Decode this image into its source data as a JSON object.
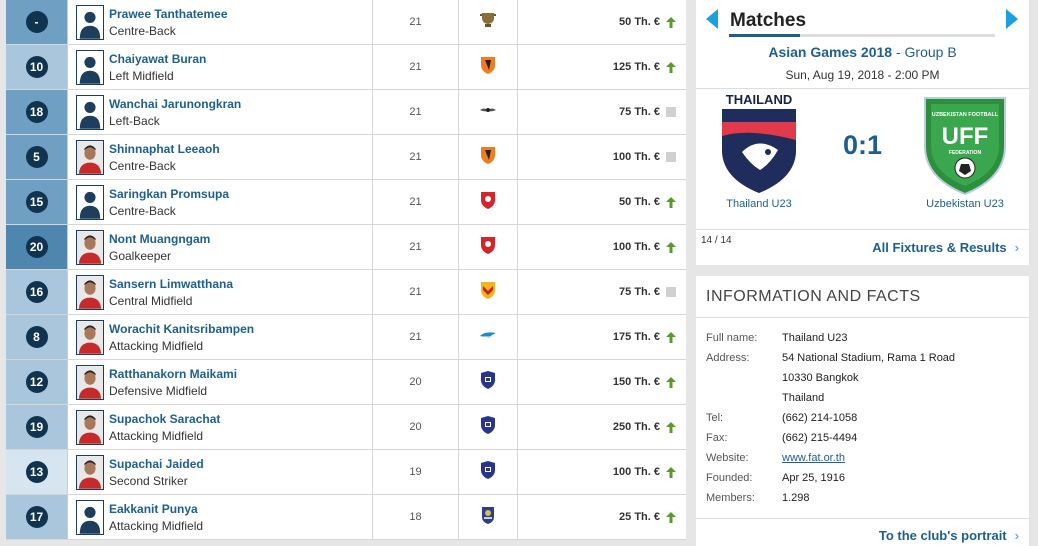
{
  "squad": [
    {
      "number": "-",
      "group": "def",
      "name": "Prawee Tanthatemee",
      "position": "Centre-Back",
      "age": "21",
      "photo": "silhouette-icon",
      "club": "trophy-club-icon",
      "value": "50 Th. €",
      "trend": "up"
    },
    {
      "number": "10",
      "group": "mid",
      "name": "Chaiyawat Buran",
      "position": "Left Midfield",
      "age": "21",
      "photo": "silhouette-icon",
      "club": "orange-shield-club-icon",
      "value": "125 Th. €",
      "trend": "up"
    },
    {
      "number": "18",
      "group": "def",
      "name": "Wanchai Jarunongkran",
      "position": "Left-Back",
      "age": "21",
      "photo": "silhouette-icon",
      "club": "winged-club-icon",
      "value": "75 Th. €",
      "trend": "flat"
    },
    {
      "number": "5",
      "group": "def",
      "name": "Shinnaphat Leeaoh",
      "position": "Centre-Back",
      "age": "21",
      "photo": "player-photo",
      "club": "orange-shield-club-icon",
      "value": "100 Th. €",
      "trend": "flat"
    },
    {
      "number": "15",
      "group": "def",
      "name": "Saringkan Promsupa",
      "position": "Centre-Back",
      "age": "21",
      "photo": "silhouette-icon",
      "club": "red-shield-club-icon",
      "value": "50 Th. €",
      "trend": "up"
    },
    {
      "number": "20",
      "group": "gk",
      "name": "Nont Muangngam",
      "position": "Goalkeeper",
      "age": "21",
      "photo": "player-photo",
      "club": "red-shield-club-icon",
      "value": "100 Th. €",
      "trend": "up"
    },
    {
      "number": "16",
      "group": "mid",
      "name": "Sansern Limwatthana",
      "position": "Central Midfield",
      "age": "21",
      "photo": "player-photo",
      "club": "yellow-red-club-icon",
      "value": "75 Th. €",
      "trend": "flat"
    },
    {
      "number": "8",
      "group": "mid",
      "name": "Worachit Kanitsribampen",
      "position": "Attacking Midfield",
      "age": "21",
      "photo": "player-photo",
      "club": "blue-winged-club-icon",
      "value": "175 Th. €",
      "trend": "up"
    },
    {
      "number": "12",
      "group": "mid",
      "name": "Ratthanakorn Maikami",
      "position": "Defensive Midfield",
      "age": "20",
      "photo": "player-photo",
      "club": "navy-shield-club-icon",
      "value": "150 Th. €",
      "trend": "up"
    },
    {
      "number": "19",
      "group": "mid",
      "name": "Supachok Sarachat",
      "position": "Attacking Midfield",
      "age": "20",
      "photo": "player-photo",
      "club": "navy-shield-club-icon",
      "value": "250 Th. €",
      "trend": "up"
    },
    {
      "number": "13",
      "group": "att",
      "name": "Supachai Jaided",
      "position": "Second Striker",
      "age": "19",
      "photo": "player-photo",
      "club": "navy-shield-club-icon",
      "value": "100 Th. €",
      "trend": "up"
    },
    {
      "number": "17",
      "group": "mid",
      "name": "Eakkanit Punya",
      "position": "Attacking Midfield",
      "age": "18",
      "photo": "silhouette-icon",
      "club": "blue-crest-club-icon",
      "value": "25 Th. €",
      "trend": "up"
    }
  ],
  "matches": {
    "title": "Matches",
    "competition": "Asian Games 2018",
    "group": " - Group B",
    "date": "Sun, Aug 19, 2018 - 2:00 PM",
    "home_crest_text": "THAILAND",
    "home": "Thailand U23",
    "away_crest_text": "UFF",
    "away_crest_top": "UZBEKISTAN FOOTBALL",
    "away_crest_bottom": "FEDERATION",
    "away": "Uzbekistan U23",
    "score": "0:1",
    "counter": "14 / 14",
    "all_fixtures": "All Fixtures & Results",
    "chevron": "›"
  },
  "info": {
    "heading": "INFORMATION AND FACTS",
    "rows": [
      {
        "label": "Full name:",
        "value": "Thailand U23"
      },
      {
        "label": "Address:",
        "value": "54 National Stadium, Rama 1 Road"
      },
      {
        "label": "",
        "value": "10330 Bangkok"
      },
      {
        "label": "",
        "value": "Thailand"
      },
      {
        "label": "Tel:",
        "value": "(662) 214-1058"
      },
      {
        "label": "Fax:",
        "value": "(662) 215-4494"
      },
      {
        "label": "Website:",
        "value": "www.fat.or.th",
        "link": true
      },
      {
        "label": "Founded:",
        "value": "Apr 25, 1916"
      },
      {
        "label": "Members:",
        "value": "1.298"
      }
    ],
    "portrait_link": "To the club's portrait"
  },
  "colors": {
    "link": "#1d5f92",
    "accent": "#19a1e0",
    "trend_up": "#5a9a2a",
    "num_circle": "#10334f"
  }
}
